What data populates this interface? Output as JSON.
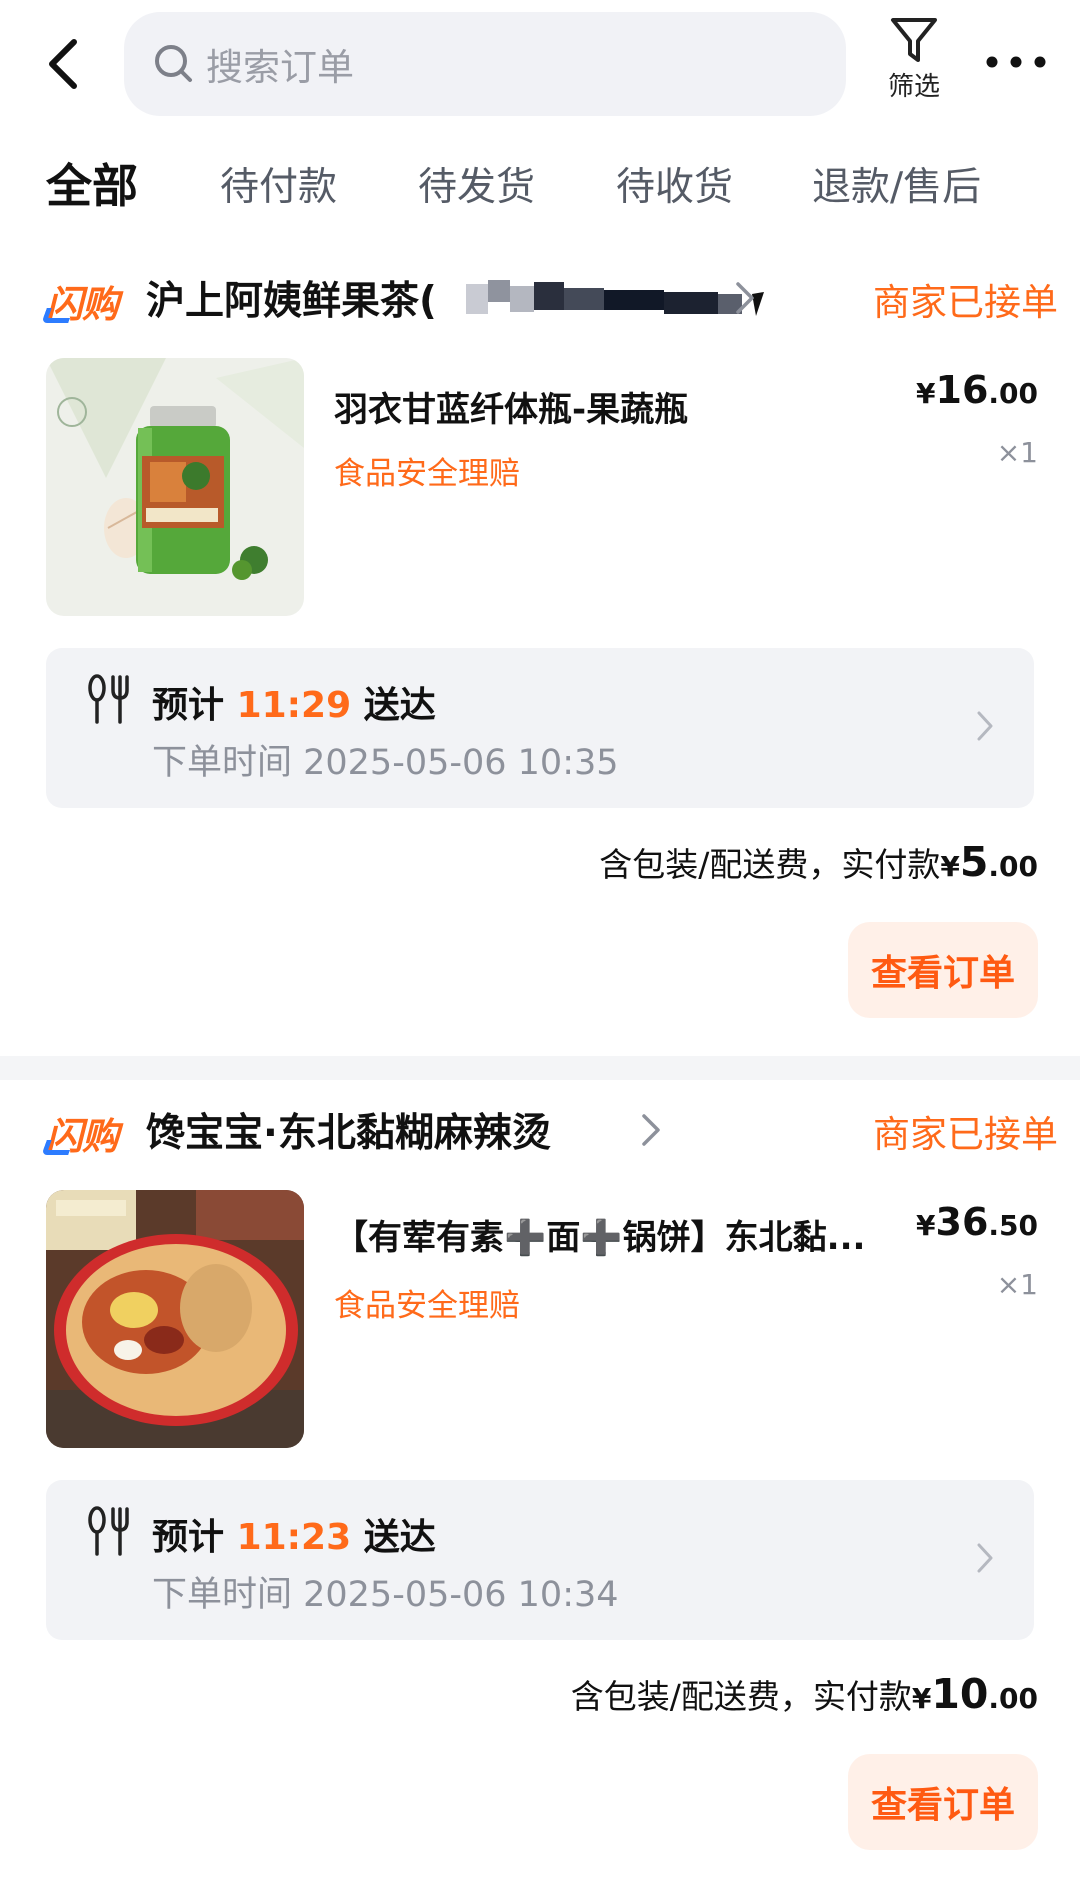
{
  "header": {
    "search_placeholder": "搜索订单",
    "filter_label": "筛选"
  },
  "tabs": [
    {
      "label": "全部",
      "active": true
    },
    {
      "label": "待付款",
      "active": false
    },
    {
      "label": "待发货",
      "active": false
    },
    {
      "label": "待收货",
      "active": false
    },
    {
      "label": "退款/售后",
      "active": false
    }
  ],
  "orders": [
    {
      "brand": "闪购",
      "shop_name": "沪上阿姨鲜果茶(",
      "status": "商家已接单",
      "product_name": "羽衣甘蓝纤体瓶-果蔬瓶",
      "tag": "食品安全理赔",
      "price_yen": "¥",
      "price_int": "16",
      "price_dec": ".00",
      "qty": "×1",
      "eta_prefix": "预计",
      "eta_time": "11:29",
      "eta_suffix": "送达",
      "order_time": "下单时间 2025-05-06 10:35",
      "paid_label": "含包装/配送费，实付款",
      "paid_yen": "¥",
      "paid_int": "5",
      "paid_dec": ".00",
      "view_label": "查看订单"
    },
    {
      "brand": "闪购",
      "shop_name": "馋宝宝·东北黏糊麻辣烫",
      "status": "商家已接单",
      "product_name": "【有荤有素➕面➕锅饼】东北黏...",
      "tag": "食品安全理赔",
      "price_yen": "¥",
      "price_int": "36",
      "price_dec": ".50",
      "qty": "×1",
      "eta_prefix": "预计",
      "eta_time": "11:23",
      "eta_suffix": "送达",
      "order_time": "下单时间 2025-05-06 10:34",
      "paid_label": "含包装/配送费，实付款",
      "paid_yen": "¥",
      "paid_int": "10",
      "paid_dec": ".00",
      "view_label": "查看订单"
    }
  ],
  "colors": {
    "accent": "#ff6a1a",
    "button_bg": "#fff0e8",
    "panel_bg": "#f2f3f6",
    "muted_text": "#8d919b"
  }
}
